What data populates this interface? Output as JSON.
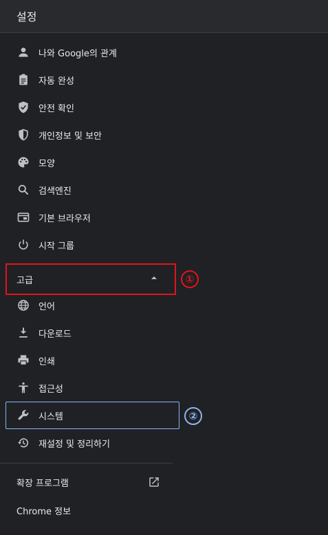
{
  "header": {
    "title": "설정"
  },
  "menu": {
    "items": [
      {
        "label": "나와 Google의 관계",
        "icon": "person-icon"
      },
      {
        "label": "자동 완성",
        "icon": "clipboard-icon"
      },
      {
        "label": "안전 확인",
        "icon": "shield-check-icon"
      },
      {
        "label": "개인정보 및 보안",
        "icon": "shield-half-icon"
      },
      {
        "label": "모양",
        "icon": "palette-icon"
      },
      {
        "label": "검색엔진",
        "icon": "search-icon"
      },
      {
        "label": "기본 브라우저",
        "icon": "browser-window-icon"
      },
      {
        "label": "시작 그룹",
        "icon": "power-icon"
      }
    ],
    "advanced": {
      "label": "고급"
    },
    "advanced_items": [
      {
        "label": "언어",
        "icon": "globe-icon"
      },
      {
        "label": "다운로드",
        "icon": "download-icon"
      },
      {
        "label": "인쇄",
        "icon": "printer-icon"
      },
      {
        "label": "접근성",
        "icon": "accessibility-icon"
      },
      {
        "label": "시스템",
        "icon": "wrench-icon"
      },
      {
        "label": "재설정 및 정리하기",
        "icon": "history-icon"
      }
    ],
    "extensions": {
      "label": "확장 프로그램",
      "icon": "open-external-icon"
    },
    "about": {
      "label": "Chrome 정보"
    }
  },
  "annotations": {
    "callout_1": "①",
    "callout_2": "②"
  },
  "colors": {
    "background": "#202124",
    "header": "#292a2d",
    "highlight_red": "#e2141a",
    "highlight_blue": "#8ab4f8",
    "icon": "#bdc1c6"
  }
}
